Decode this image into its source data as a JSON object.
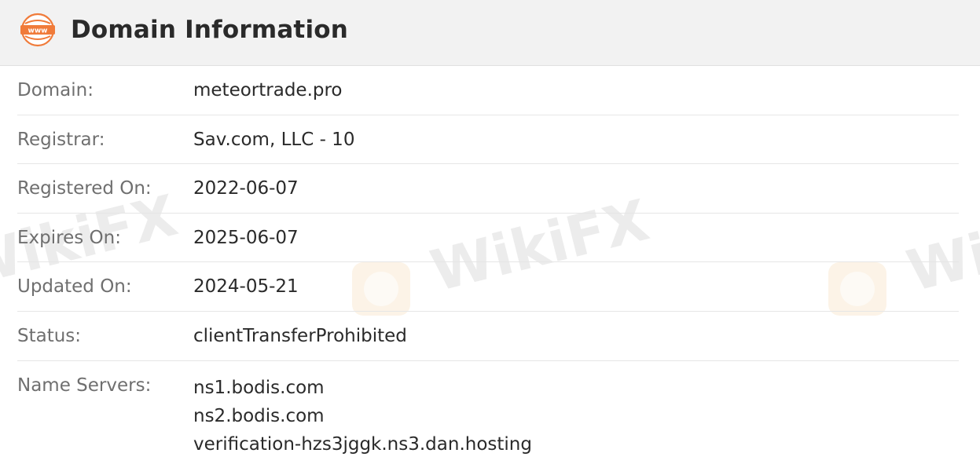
{
  "header": {
    "title": "Domain Information",
    "icon": "www-globe-icon",
    "icon_text": "www",
    "icon_color": "#f07b3a"
  },
  "watermark": {
    "text": "WikiFX",
    "color": "#e9a94f"
  },
  "rows": [
    {
      "label": "Domain:",
      "value": "meteortrade.pro"
    },
    {
      "label": "Registrar:",
      "value": "Sav.com, LLC - 10"
    },
    {
      "label": "Registered On:",
      "value": "2022-06-07"
    },
    {
      "label": "Expires On:",
      "value": "2025-06-07"
    },
    {
      "label": "Updated On:",
      "value": "2024-05-21"
    },
    {
      "label": "Status:",
      "value": "clientTransferProhibited"
    }
  ],
  "name_servers": {
    "label": "Name Servers:",
    "values": [
      "ns1.bodis.com",
      "ns2.bodis.com",
      "verification-hzs3jggk.ns3.dan.hosting"
    ]
  }
}
